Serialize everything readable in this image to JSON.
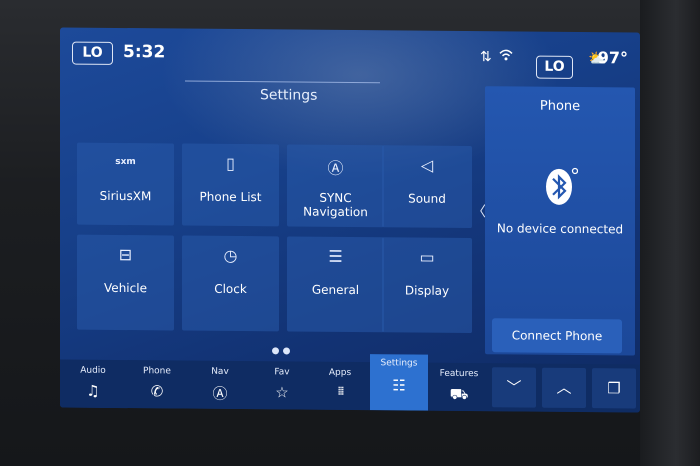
{
  "status": {
    "left_climate": "LO",
    "time": "5:32",
    "right_climate": "LO",
    "outside_temp": "97°"
  },
  "page_title": "Settings",
  "tiles": [
    {
      "label": "SiriusXM",
      "icon": "siriusxm-icon",
      "glyph": "sxm"
    },
    {
      "label": "Phone List",
      "icon": "phone-list-icon",
      "glyph": "▯"
    },
    {
      "label": "SYNC Navigation",
      "icon": "navigation-icon",
      "glyph": "Ⓐ"
    },
    {
      "label": "Sound",
      "icon": "speaker-icon",
      "glyph": "◁"
    },
    {
      "label": "Vehicle",
      "icon": "vehicle-icon",
      "glyph": "⊟"
    },
    {
      "label": "Clock",
      "icon": "clock-icon",
      "glyph": "◷"
    },
    {
      "label": "General",
      "icon": "sliders-icon",
      "glyph": "☰"
    },
    {
      "label": "Display",
      "icon": "display-icon",
      "glyph": "▭"
    }
  ],
  "phone_panel": {
    "title": "Phone",
    "message": "No device connected",
    "connect_label": "Connect Phone"
  },
  "nav": [
    {
      "label": "Audio",
      "glyph": "♫"
    },
    {
      "label": "Phone",
      "glyph": "✆"
    },
    {
      "label": "Nav",
      "glyph": "Ⓐ"
    },
    {
      "label": "Fav",
      "glyph": "☆"
    },
    {
      "label": "Apps",
      "glyph": "⁞⁞⁞"
    },
    {
      "label": "Settings",
      "glyph": "☷"
    },
    {
      "label": "Features",
      "glyph": "⛟"
    }
  ],
  "controls": {
    "down_glyph": "﹀",
    "up_glyph": "︿",
    "windows_glyph": "❐"
  },
  "colors": {
    "screen": "#17408a",
    "active_tab": "#2d71d0",
    "bluetooth": "#ffffff"
  }
}
